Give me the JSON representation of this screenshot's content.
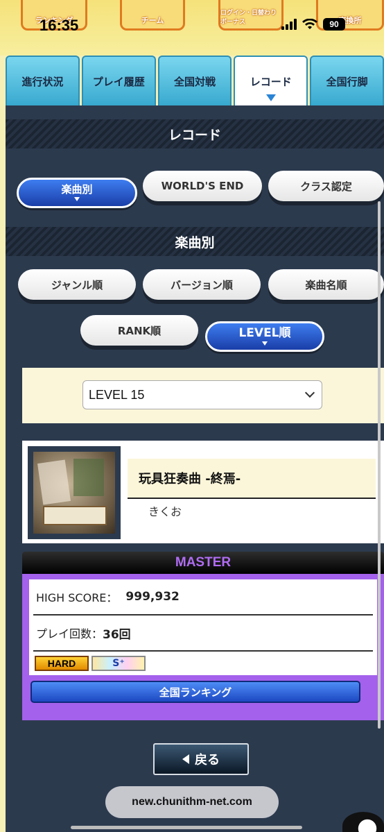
{
  "status_bar": {
    "time": "16:35",
    "battery": "90"
  },
  "top_menu": [
    {
      "label": "ランキング"
    },
    {
      "label": "チーム"
    },
    {
      "label": "ログイン・日替わりボーナス"
    },
    {
      "label": "交換所"
    }
  ],
  "tabs": [
    {
      "label": "進行状況"
    },
    {
      "label": "プレイ履歴"
    },
    {
      "label": "全国対戦"
    },
    {
      "label": "レコード"
    },
    {
      "label": "全国行脚"
    }
  ],
  "record": {
    "heading": "レコード",
    "categories": [
      "楽曲別",
      "WORLD'S END",
      "クラス認定"
    ],
    "sub_heading": "楽曲別",
    "sorts": [
      "ジャンル順",
      "バージョン順",
      "楽曲名順",
      "RANK順",
      "LEVEL順"
    ]
  },
  "level_select": {
    "value": "LEVEL 15"
  },
  "song": {
    "title": "玩具狂奏曲 -終焉-",
    "artist": "きくお"
  },
  "difficulty": {
    "name": "MASTER",
    "high_score_label": "HIGH SCORE：",
    "high_score": "999,932",
    "play_count_label": "プレイ回数：",
    "play_count": "36回",
    "clear_badge": "HARD",
    "rank_badge": "S⁺",
    "ranking_button": "全国ランキング"
  },
  "back_button": "戻る",
  "url": "new.chunithm-net.com"
}
